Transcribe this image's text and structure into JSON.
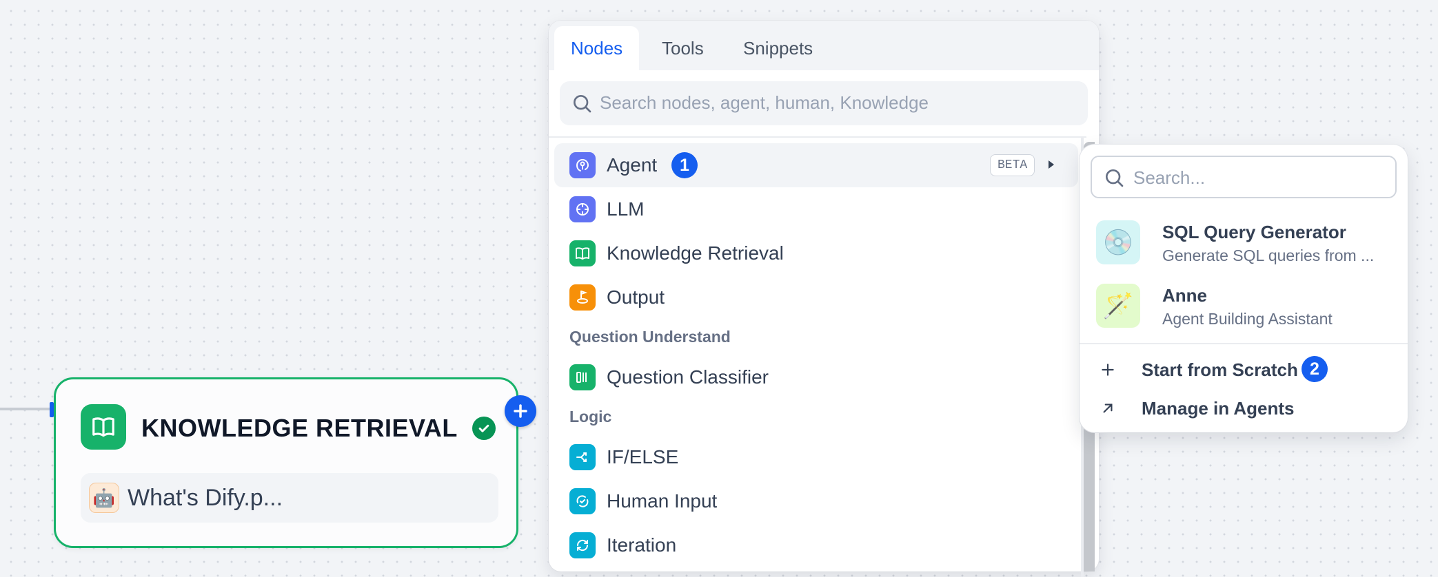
{
  "canvas": {
    "node": {
      "title": "KNOWLEDGE RETRIEVAL",
      "knowledge_item": {
        "avatar": "🤖",
        "name": "What's Dify.p..."
      }
    }
  },
  "node_selector": {
    "tabs": [
      {
        "label": "Nodes",
        "active": true
      },
      {
        "label": "Tools",
        "active": false
      },
      {
        "label": "Snippets",
        "active": false
      }
    ],
    "search_placeholder": "Search nodes, agent, human, Knowledge",
    "items": [
      {
        "label": "Agent",
        "icon": "agent-icon",
        "color": "#6172f3",
        "badge_number": "1",
        "tag": "BETA"
      },
      {
        "label": "LLM",
        "icon": "llm-icon",
        "color": "#6172f3"
      },
      {
        "label": "Knowledge Retrieval",
        "icon": "book-icon",
        "color": "#17b26a"
      },
      {
        "label": "Output",
        "icon": "output-icon",
        "color": "#f79009"
      }
    ],
    "section_question": "Question Understand",
    "question_items": [
      {
        "label": "Question Classifier",
        "icon": "classifier-icon",
        "color": "#17b26a"
      }
    ],
    "section_logic": "Logic",
    "logic_items": [
      {
        "label": "IF/ELSE",
        "icon": "branch-icon",
        "color": "#06aed4"
      },
      {
        "label": "Human Input",
        "icon": "human-input-icon",
        "color": "#06aed4"
      },
      {
        "label": "Iteration",
        "icon": "iteration-icon",
        "color": "#06aed4"
      }
    ]
  },
  "agent_submenu": {
    "search_placeholder": "Search...",
    "agents": [
      {
        "name": "SQL Query Generator",
        "description": "Generate SQL queries from ...",
        "avatar": "💿",
        "avatar_bg": "#d5f5f6"
      },
      {
        "name": "Anne",
        "description": "Agent Building Assistant",
        "avatar": "🪄",
        "avatar_bg": "#e3fbcc"
      }
    ],
    "start_from_scratch": "Start from Scratch",
    "start_badge": "2",
    "manage_in_agents": "Manage in Agents"
  },
  "colors": {
    "accent": "#155eef",
    "success": "#17b26a"
  }
}
